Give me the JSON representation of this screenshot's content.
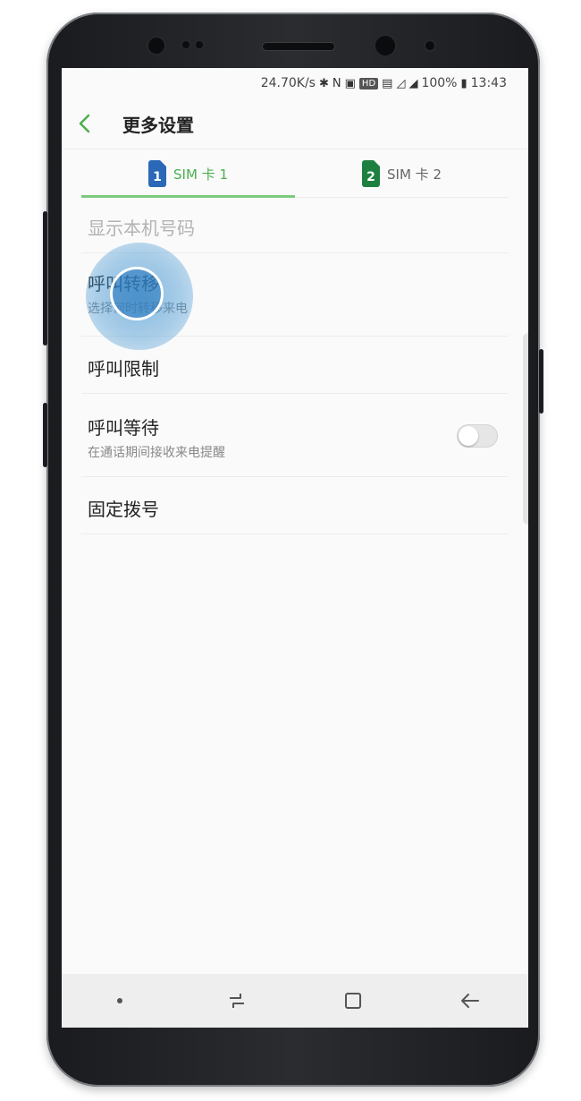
{
  "status_bar": {
    "speed": "24.70K/s",
    "bluetooth": "✱",
    "nfc": "N",
    "hd_badge": "HD",
    "battery_percent": "100%",
    "time": "13:43"
  },
  "header": {
    "title": "更多设置"
  },
  "tabs": [
    {
      "number": "1",
      "label": "SIM 卡 1"
    },
    {
      "number": "2",
      "label": "SIM 卡 2"
    }
  ],
  "settings": {
    "show_number": {
      "title": "显示本机号码"
    },
    "call_forwarding": {
      "title": "呼叫转移",
      "subtitle": "选择何时转移来电"
    },
    "call_barring": {
      "title": "呼叫限制"
    },
    "call_waiting": {
      "title": "呼叫等待",
      "subtitle": "在通话期间接收来电提醒",
      "enabled": false
    },
    "fixed_dialing": {
      "title": "固定拨号"
    }
  },
  "colors": {
    "accent": "#4caf50",
    "sim1": "#2b68b8",
    "sim2": "#1d8040",
    "touch_indicator": "#4496d2"
  },
  "icons": {
    "back": "chevron-left-icon",
    "nav_dot": "dot-icon",
    "recents": "recent-apps-icon",
    "home": "home-icon",
    "nav_back": "back-arrow-icon"
  }
}
